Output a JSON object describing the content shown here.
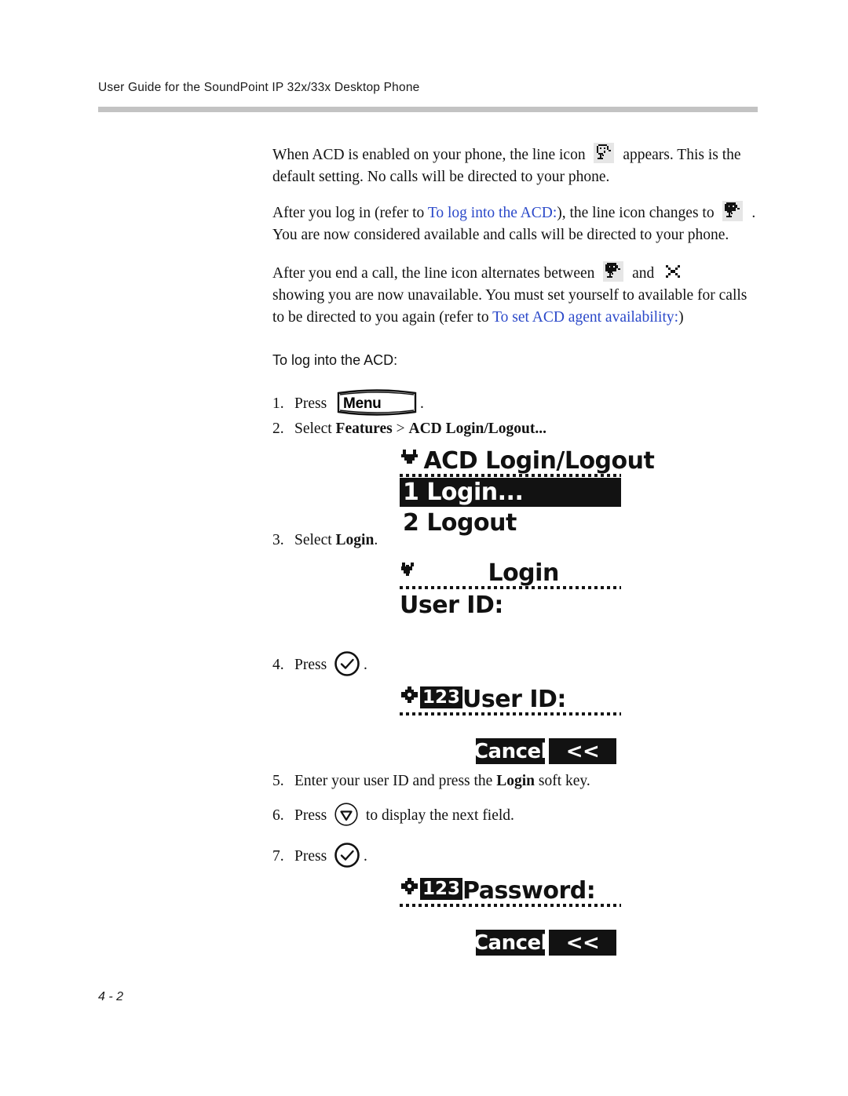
{
  "header": {
    "title": "User Guide for the SoundPoint IP 32x/33x Desktop Phone"
  },
  "footer": {
    "page_number": "4 - 2"
  },
  "colors": {
    "link": "#2b49c9",
    "rule": "#c3c3c3",
    "lcd_ink": "#121212",
    "icon_shade": "#e6e6e6"
  },
  "paragraphs": {
    "p1": {
      "line1a": "When ACD is enabled on your phone, the line icon",
      "icon": "acd-agent-logged-out-icon",
      "line1b": "appears. This is the",
      "line2": "default setting. No calls will be directed to your phone."
    },
    "p2": {
      "line1a": "After you log in (refer to",
      "link": "To log into the ACD:",
      "line1b": "), the line icon changes to",
      "icon": "acd-agent-available-icon",
      "line1c": ".",
      "line2": "You are now considered available and calls will be directed to your phone."
    },
    "p3": {
      "line1a": "After you end a call, the line icon alternates between",
      "icon_a": "acd-agent-available-icon",
      "line1b": "and",
      "icon_b": "acd-agent-unavailable-x-icon",
      "line2": "showing you are now unavailable. You must set yourself to available for calls",
      "line3a": "to be directed to you again (refer to",
      "link": "To set ACD agent availability:",
      "line3b": ")"
    }
  },
  "procedure": {
    "label": "To log into the ACD:",
    "steps": [
      {
        "num": "1.",
        "pre": "Press",
        "key": "Menu",
        "post": "."
      },
      {
        "num": "2.",
        "pre": "Select",
        "bold1": "Features",
        "mid": ">",
        "bold2": "ACD Login/Logout...",
        "post": ""
      },
      {
        "num": "3.",
        "pre": "Select",
        "bold1": "Login",
        "post": "."
      },
      {
        "num": "4.",
        "pre": "Press",
        "key_icon": "select-checkmark-key-icon",
        "post": "."
      },
      {
        "num": "5.",
        "pre": "Enter your user ID and press the",
        "bold1": "Login",
        "post": "soft key."
      },
      {
        "num": "6.",
        "pre": "Press",
        "key_icon": "down-arrow-key-icon",
        "post": "to display the next field."
      },
      {
        "num": "7.",
        "pre": "Press",
        "key_icon": "select-checkmark-key-icon",
        "post": "."
      }
    ]
  },
  "lcd_screens": [
    {
      "name": "acd-login-logout-menu",
      "icon": "down-arrow-nav-icon",
      "title": "ACD Login/Logout",
      "items": [
        {
          "label": "1 Login...",
          "selected": true
        },
        {
          "label": "2 Logout",
          "selected": false
        }
      ]
    },
    {
      "name": "login-user-id-screen",
      "icon": "back-arrow-nav-icon",
      "title": "Login",
      "field_label": "User ID:"
    },
    {
      "name": "user-id-entry-screen",
      "icon": "four-way-nav-icon",
      "mode_badge": "123",
      "field_label": "User ID:",
      "soft_keys": [
        "Cancel",
        "<<"
      ]
    },
    {
      "name": "password-entry-screen",
      "icon": "four-way-nav-icon",
      "mode_badge": "123",
      "field_label": "Password:",
      "soft_keys": [
        "Cancel",
        "<<"
      ]
    }
  ]
}
